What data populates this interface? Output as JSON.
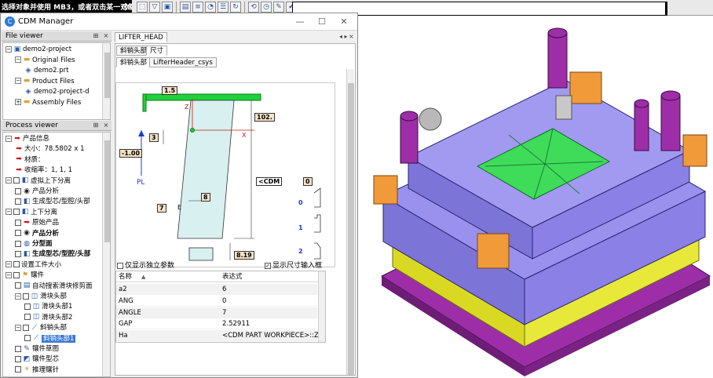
{
  "topbar": {
    "prompt": "选择对象并使用 MB3，或者双击某一对象",
    "toolbar_icons": [
      "select-icon",
      "filter-icon",
      "box-icon",
      "folder-icon",
      "layers-icon",
      "graph-icon",
      "list-icon",
      "refresh-icon",
      "rotate-icon",
      "clock-icon",
      "note-icon",
      "check-icon",
      "wand-icon",
      "window-icon"
    ]
  },
  "cdm": {
    "title": "CDM Manager",
    "file_viewer": {
      "header": "File viewer",
      "items": [
        {
          "label": "demo2-project",
          "icon": "project-icon",
          "level": 0
        },
        {
          "label": "Original Files",
          "icon": "folder-icon",
          "level": 1
        },
        {
          "label": "demo2.prt",
          "icon": "part-file-icon",
          "level": 2
        },
        {
          "label": "Product Files",
          "icon": "folder-icon",
          "level": 1
        },
        {
          "label": "demo2-project-d",
          "icon": "part-file-icon",
          "level": 2
        },
        {
          "label": "Assembly Files",
          "icon": "folder-icon",
          "level": 1
        }
      ]
    },
    "process_viewer": {
      "header": "Process viewer",
      "items": [
        {
          "label": "产品信息",
          "icon": "arrow-icon",
          "level": 0,
          "checkbox": false
        },
        {
          "label": "大小：78.5802 x 1",
          "icon": "arrow-icon",
          "level": 1,
          "checkbox": false
        },
        {
          "label": "材质：",
          "icon": "arrow-icon",
          "level": 1,
          "checkbox": false
        },
        {
          "label": "收缩率：1, 1, 1",
          "icon": "arrow-icon",
          "level": 1,
          "checkbox": false
        },
        {
          "label": "虚拟上下分离",
          "icon": "split-icon",
          "level": 0,
          "checkbox": true
        },
        {
          "label": "产品分析",
          "icon": "eye-icon",
          "level": 1,
          "checkbox": true
        },
        {
          "label": "生成型芯/型腔/头部",
          "icon": "split-icon",
          "level": 1,
          "checkbox": true
        },
        {
          "label": "上下分离",
          "icon": "split-icon",
          "level": 0,
          "checkbox": true
        },
        {
          "label": "原始产品",
          "icon": "arrow-icon",
          "level": 1,
          "checkbox": true
        },
        {
          "label": "产品分析",
          "icon": "eye-icon",
          "level": 1,
          "checkbox": true,
          "bold": true
        },
        {
          "label": "分型面",
          "icon": "parting-icon",
          "level": 1,
          "checkbox": true,
          "bold": true
        },
        {
          "label": "生成型芯/型腔/头部",
          "icon": "split-icon",
          "level": 1,
          "checkbox": true,
          "bold": true
        },
        {
          "label": "设置工件大小",
          "icon": "",
          "level": 0,
          "checkbox": true
        },
        {
          "label": "镶件",
          "icon": "insert-icon",
          "level": 0,
          "checkbox": true
        },
        {
          "label": "自动搜索滑块修剪面",
          "icon": "doc-icon",
          "level": 1,
          "checkbox": true
        },
        {
          "label": "滑块头部",
          "icon": "slider-icon",
          "level": 1,
          "checkbox": true
        },
        {
          "label": "滑块头部1",
          "icon": "slider-icon",
          "level": 2,
          "checkbox": true
        },
        {
          "label": "滑块头部2",
          "icon": "slider-icon",
          "level": 2,
          "checkbox": true
        },
        {
          "label": "斜销头部",
          "icon": "lifter-icon",
          "level": 1,
          "checkbox": true
        },
        {
          "label": "斜销头部1",
          "icon": "lifter-icon",
          "level": 2,
          "checkbox": true,
          "selected": true
        },
        {
          "label": "镶件草图",
          "icon": "sketch-icon",
          "level": 1,
          "checkbox": true
        },
        {
          "label": "镶件型芯",
          "icon": "core-icon",
          "level": 1,
          "checkbox": true
        },
        {
          "label": "推理镶针",
          "icon": "bulb-icon",
          "level": 1,
          "checkbox": true
        }
      ]
    },
    "right_pane": {
      "title_tab": "LIFTER_HEAD",
      "tabs": [
        "斜销头部",
        "尺寸"
      ],
      "subtabs": [
        "斜销头部",
        "LifterHeader_csys"
      ],
      "drawing": {
        "dim_top": "1.5",
        "dim_height": "102.",
        "dim_offset": "3",
        "dim_minus": "-1.00",
        "dim_angle": "8",
        "dim_e": "7",
        "dim_bottom": "8.19",
        "dim_cdm": "<CDM",
        "dim_zero": "0",
        "label_z": "Z",
        "label_x": "X",
        "label_pl": "PL",
        "label_e": "E",
        "variant_labels": [
          "0",
          "1",
          "2"
        ]
      },
      "only_independent": "仅显示独立参数",
      "show_dim_input": "显示尺寸输入框",
      "table": {
        "columns": [
          "名称",
          "表达式"
        ],
        "rows": [
          {
            "name": "a2",
            "expr": "6"
          },
          {
            "name": "ANG",
            "expr": "0"
          },
          {
            "name": "ANGLE",
            "expr": "7"
          },
          {
            "name": "GAP",
            "expr": "2.52911"
          },
          {
            "name": "Ha",
            "expr": "<CDM PART WORKPIECE>::Z2..."
          }
        ]
      }
    }
  },
  "colors": {
    "mold_purple": "#8a80e6",
    "mold_violet": "#9d2ea8",
    "mold_yellow": "#d9d924",
    "mold_orange": "#f09a3a",
    "mold_green": "#2fb05a",
    "mold_teal": "#4ab8b0",
    "selection_blue": "#3b78d4"
  }
}
